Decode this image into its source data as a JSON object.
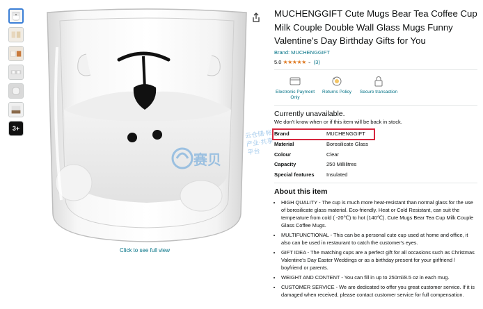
{
  "product": {
    "title": "MUCHENGGIFT Cute Mugs Bear Tea Coffee Cup Milk Couple Double Wall Glass Mugs Funny Valentine's Day Birthday Gifts for You",
    "brand_link": "Brand: MUCHENGGIFT",
    "rating_value": "5.0",
    "stars": "★★★★★",
    "rating_count": "(3)"
  },
  "thumbnails": {
    "more_label": "3+"
  },
  "image": {
    "see_full_view": "Click to see full view"
  },
  "badges": [
    {
      "label": "Electronic Payment Only",
      "icon": "card-icon"
    },
    {
      "label": "Returns Policy",
      "icon": "returns-icon"
    },
    {
      "label": "Secure transaction",
      "icon": "lock-icon"
    }
  ],
  "availability": {
    "status": "Currently unavailable.",
    "note": "We don't know when or if this item will be back in stock."
  },
  "specs": [
    {
      "key": "Brand",
      "value": "MUCHENGGIFT"
    },
    {
      "key": "Material",
      "value": "Borosilicate Glass"
    },
    {
      "key": "Colour",
      "value": "Clear"
    },
    {
      "key": "Capacity",
      "value": "250 Millilitres"
    },
    {
      "key": "Special features",
      "value": "Insulated"
    }
  ],
  "about": {
    "title": "About this item",
    "bullets": [
      "HIGH QUALITY - The cup is much more heat-resistant than normal glass for the use of borosilicate glass material. Eco-friendly. Heat or Cold Resistant, can suit the temperature from cold ( -20℃) to hot (140℃). Cute Mugs Bear Tea Cup Milk Couple Glass Coffee Mugs.",
      "MULTIFUNCTIONAL - This can be a personal cute cup used at home and office, it also can be used in restaurant to catch the customer's eyes.",
      "GIFT IDEA - The matching cups are a perfect gift for all occasions such as Christmas Valentine's Day Easter Weddings or as a birthday present for your girlfriend / boyfriend or parents.",
      "WEIGHT AND CONTENT - You can fill in up to 250ml/8.5 oz in each mug.",
      "CUSTOMER SERVICE - We are dedicated to offer you great customer service. If it is damaged when received, please contact customer service for full compensation."
    ]
  },
  "watermark": {
    "text1": "赛贝",
    "text2": "云仓储·帐 产业·共享平台"
  },
  "colors": {
    "link": "#007185",
    "star": "#de7921",
    "highlight": "#d7263d"
  }
}
